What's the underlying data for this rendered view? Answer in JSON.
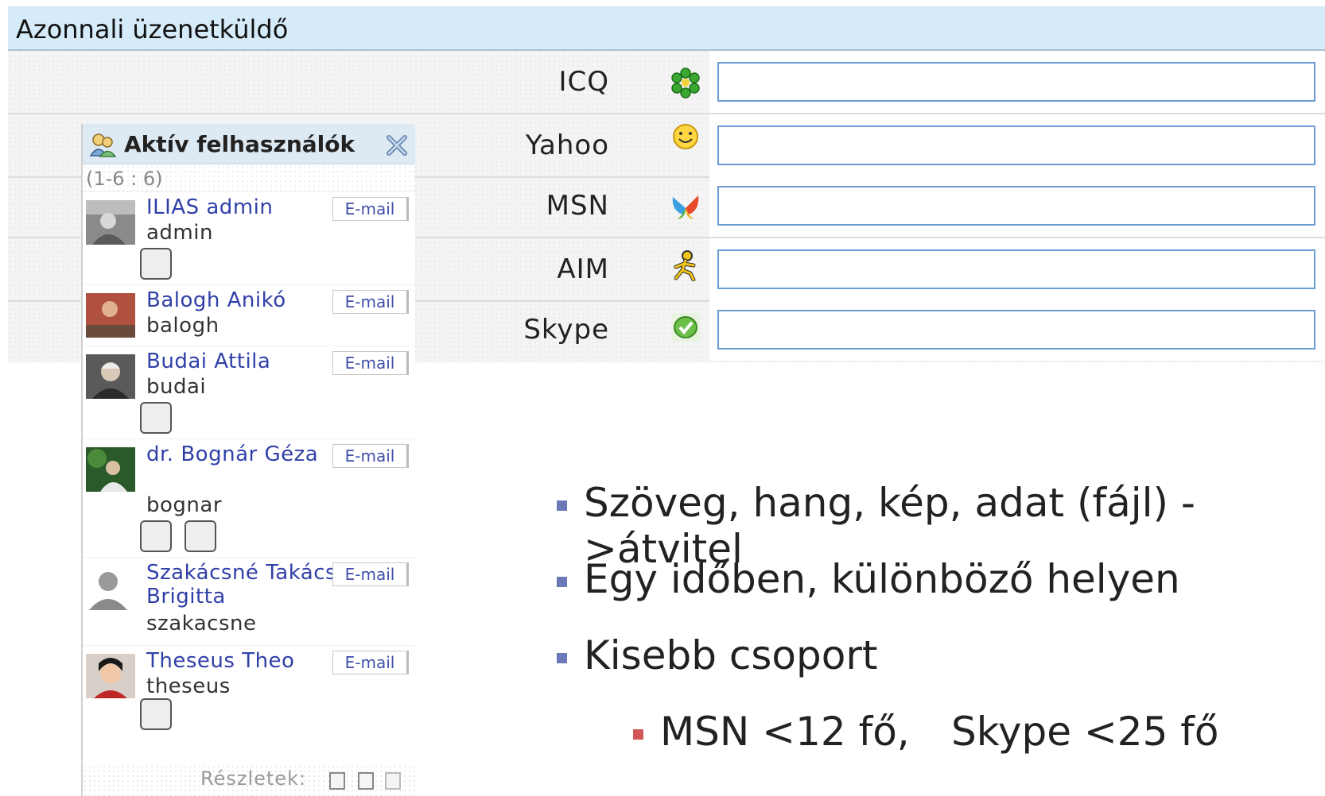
{
  "messenger": {
    "title": "Azonnali üzenetküldő",
    "fields": [
      {
        "label": "ICQ",
        "icon": "icq-flower-icon",
        "value": ""
      },
      {
        "label": "Yahoo",
        "icon": "yahoo-smiley-icon",
        "value": ""
      },
      {
        "label": "MSN",
        "icon": "msn-butterfly-icon",
        "value": ""
      },
      {
        "label": "AIM",
        "icon": "aim-running-man-icon",
        "value": ""
      },
      {
        "label": "Skype",
        "icon": "skype-icon",
        "value": ""
      }
    ]
  },
  "active_users": {
    "title": "Aktív felhasználók",
    "count": "(1-6 : 6)",
    "email_label": "E-mail",
    "details_label": "Részletek:",
    "users": [
      {
        "name": "ILIAS admin",
        "login": "admin"
      },
      {
        "name": "Balogh Anikó",
        "login": "balogh"
      },
      {
        "name": "Budai Attila",
        "login": "budai"
      },
      {
        "name": "dr. Bognár Géza",
        "login": "bognar"
      },
      {
        "name": "Szakácsné Takács Brigitta",
        "login": "szakacsne"
      },
      {
        "name": "Theseus Theo",
        "login": "theseus"
      }
    ]
  },
  "bullets": {
    "items": [
      "Szöveg, hang, kép, adat (fájl) ->átvitel",
      "Egy időben, különböző helyen",
      "Kisebb csoport"
    ],
    "sub_items": [
      "MSN <12 fő,",
      "Skype <25 fő"
    ]
  },
  "colors": {
    "header_bg": "#d6ebfa",
    "input_border": "#6c9cd4",
    "link": "#3040a8",
    "bullet": "#6c78b8",
    "sub_bullet": "#d05858"
  }
}
